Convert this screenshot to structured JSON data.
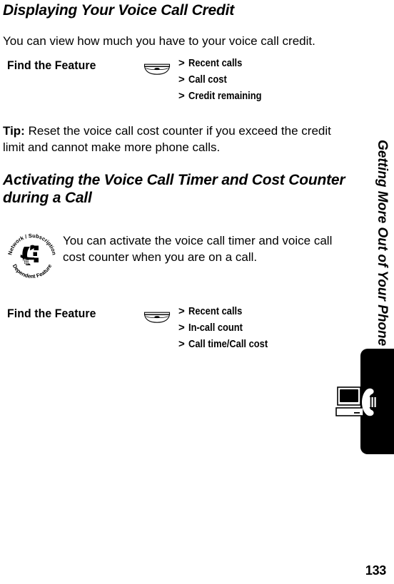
{
  "page": {
    "number": "133",
    "sidebar_title": "Getting More Out of Your Phone"
  },
  "sections": [
    {
      "heading": "Displaying Your Voice Call Credit",
      "intro": "You can view how much you have to your voice call credit.",
      "find_the_feature": {
        "label": "Find the Feature",
        "key_icon": "menu-key-icon",
        "path": [
          {
            "separator": ">",
            "item": "Recent calls"
          },
          {
            "separator": ">",
            "item": "Call cost"
          },
          {
            "separator": ">",
            "item": "Credit remaining"
          }
        ]
      },
      "tip": {
        "label": "Tip:",
        "text": " Reset the voice call cost counter if you exceed the credit limit and cannot make more phone calls."
      }
    },
    {
      "heading": "Activating the Voice Call Timer and Cost Counter during a Call",
      "badge": {
        "icon": "network-subscription-dependent-feature-icon",
        "text_top": "Network / Subscription",
        "text_bottom": "Dependent  Feature"
      },
      "intro": "You can activate the voice call timer and voice call cost counter when you are on a call.",
      "find_the_feature": {
        "label": "Find the Feature",
        "key_icon": "menu-key-icon",
        "path": [
          {
            "separator": ">",
            "item": "Recent calls"
          },
          {
            "separator": ">",
            "item": "In-call count"
          },
          {
            "separator": ">",
            "item": "Call time/Call cost"
          }
        ]
      }
    }
  ],
  "colors": {
    "ink": "#000000",
    "paper": "#ffffff",
    "tab": "#000000"
  }
}
